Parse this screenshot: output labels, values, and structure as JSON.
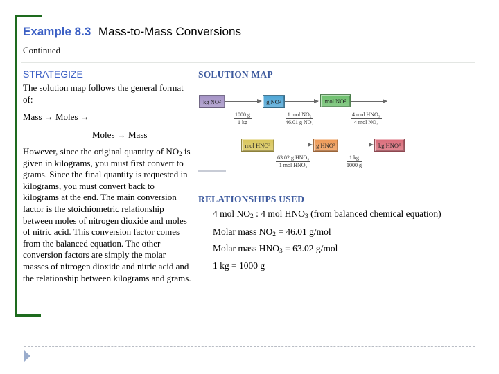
{
  "header": {
    "example_number": "Example 8.3",
    "example_title": "Mass-to-Mass Conversions",
    "continued": "Continued"
  },
  "strategize": {
    "heading": "STRATEGIZE",
    "intro": "The solution map follows the general format of:",
    "format_line1": "Mass → Moles →",
    "format_line2": "Moles → Mass",
    "explanation_parts": {
      "a": "However, since the original quantity of NO",
      "a_sub": "2",
      "b": " is given in kilograms, you must first convert to grams. Since the final quantity is requested in kilograms, you must convert back to kilograms at the end. The main conversion factor is the stoichiometric relationship between moles of nitrogen dioxide and moles of nitric acid. This conversion factor comes from the balanced equation. The other conversion factors are simply the molar masses of nitrogen dioxide and nitric acid and the relationship between kilograms and grams."
    }
  },
  "solution_map": {
    "heading": "SOLUTION MAP",
    "nodes": [
      {
        "label": "kg NO",
        "sub": "2",
        "color": "#a593c6"
      },
      {
        "label": "g NO",
        "sub": "2",
        "color": "#4fa6d6"
      },
      {
        "label": "mol NO",
        "sub": "2",
        "color": "#6cbf6c"
      },
      {
        "label": "mol HNO",
        "sub": "3",
        "color": "#d9c65a"
      },
      {
        "label": "g HNO",
        "sub": "3",
        "color": "#ef9a56"
      },
      {
        "label": "kg HNO",
        "sub": "3",
        "color": "#db6c7a"
      }
    ],
    "factors": [
      {
        "numerator": "1000 g",
        "denominator": "1 kg"
      },
      {
        "numerator": "1 mol NO₂",
        "denominator": "46.01 g NO₂"
      },
      {
        "numerator": "4 mol HNO₃",
        "denominator": "4 mol NO₂"
      },
      {
        "numerator": "63.02 g HNO₃",
        "denominator": "1 mol HNO₃"
      },
      {
        "numerator": "1 kg",
        "denominator": "1000 g"
      }
    ]
  },
  "relationships": {
    "heading": "RELATIONSHIPS USED",
    "items": [
      {
        "pre": "4 mol NO",
        "sub1": "2",
        "mid": " : 4 mol HNO",
        "sub2": "3",
        "post": " (from balanced chemical equation)"
      },
      {
        "pre": "Molar mass NO",
        "sub1": "2",
        "post": " = 46.01 g/mol"
      },
      {
        "pre": "Molar mass HNO",
        "sub1": "3",
        "post": " = 63.02 g/mol"
      },
      {
        "pre": "1 kg = 1000 g"
      }
    ]
  },
  "colors": {
    "accent_blue": "#3b5fc4",
    "bracket_green": "#1e6b1e",
    "heading_serif_blue": "#3d5a9e"
  }
}
